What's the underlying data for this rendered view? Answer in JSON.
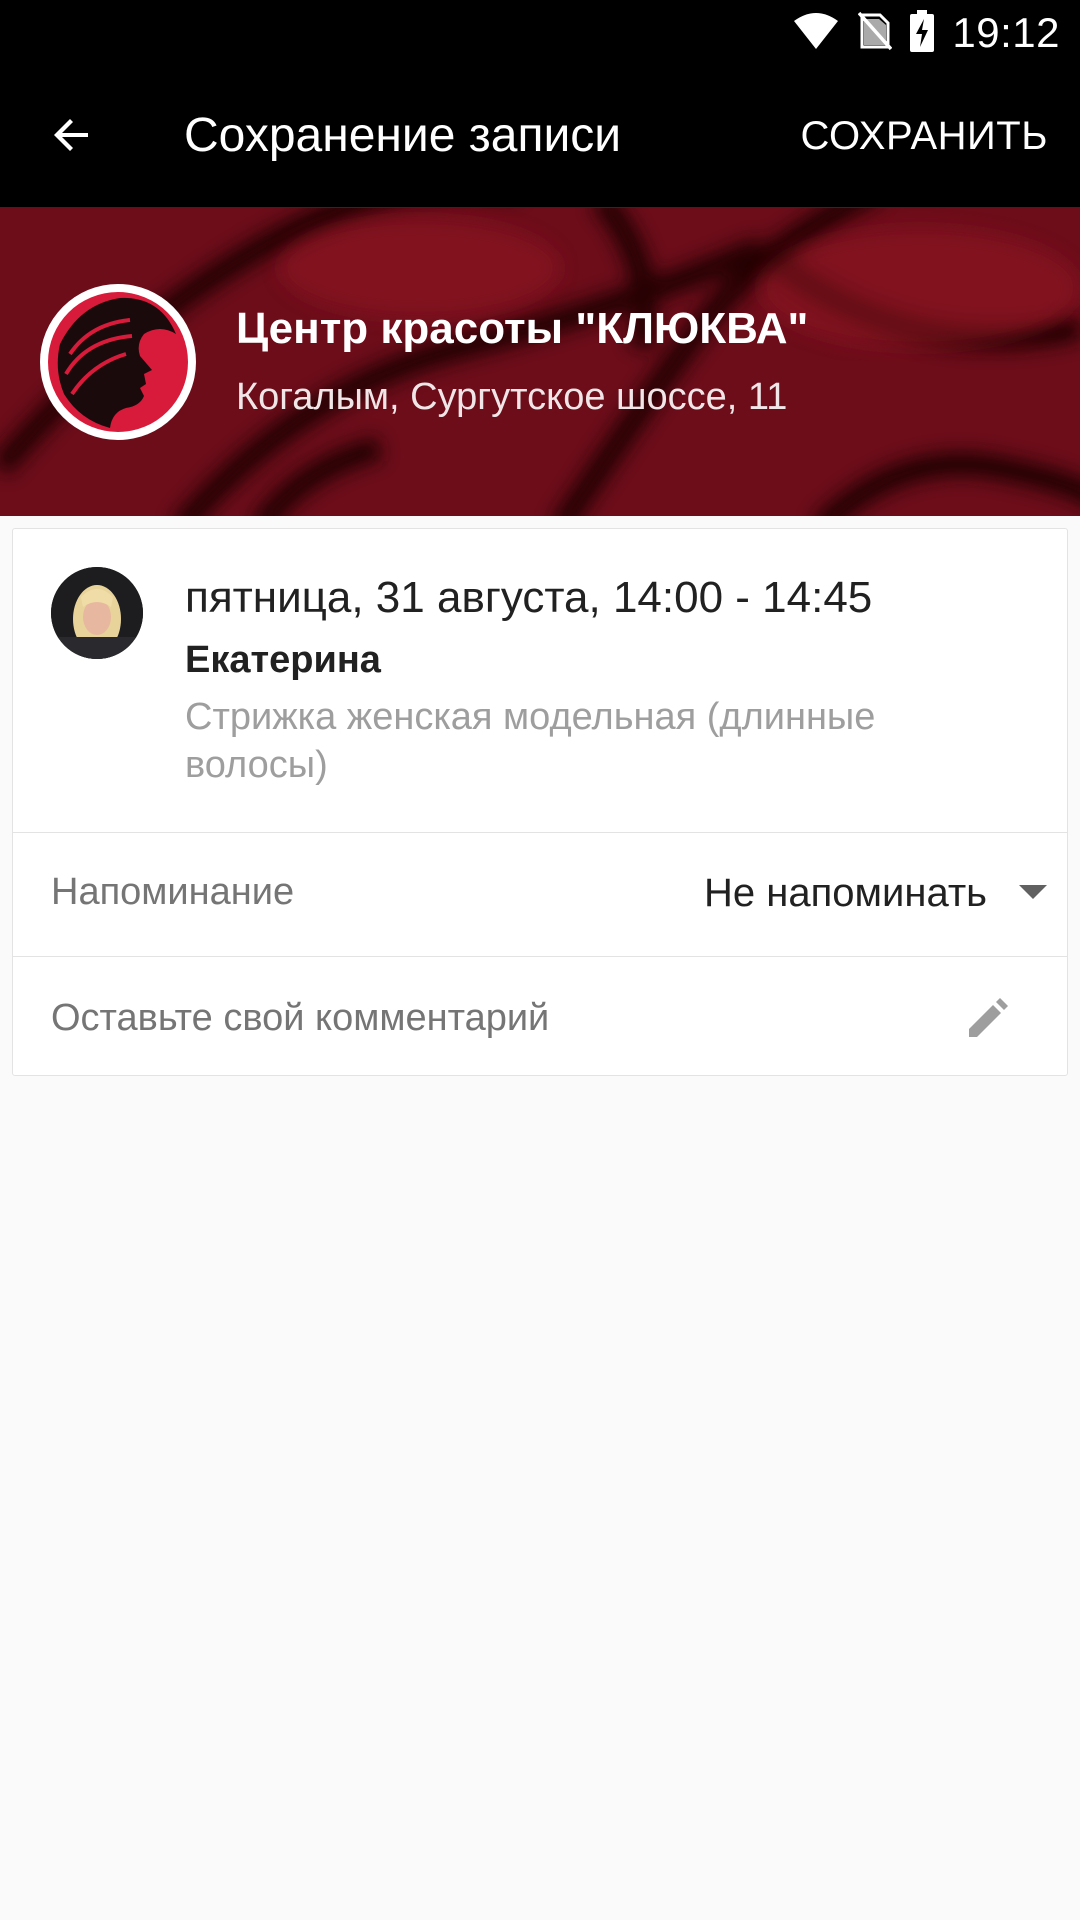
{
  "status_bar": {
    "time": "19:12",
    "icons": [
      "wifi-icon",
      "no-sim-icon",
      "battery-charging-icon"
    ]
  },
  "app_bar": {
    "title": "Сохранение записи",
    "action_label": "СОХРАНИТЬ",
    "back_icon": "arrow-back-icon"
  },
  "salon": {
    "name": "Центр красоты \"КЛЮКВА\"",
    "address": "Когалым, Сургутское шоссе, 11",
    "logo_icon": "salon-logo",
    "accent_color": "#6d0d1a"
  },
  "booking": {
    "datetime": "пятница, 31 августа, 14:00 - 14:45",
    "master_name": "Екатерина",
    "service": "Стрижка женская модельная (длинные волосы)"
  },
  "reminder": {
    "label": "Напоминание",
    "value": "Не напоминать"
  },
  "comment": {
    "placeholder": "Оставьте свой комментарий",
    "icon": "pencil-icon"
  }
}
